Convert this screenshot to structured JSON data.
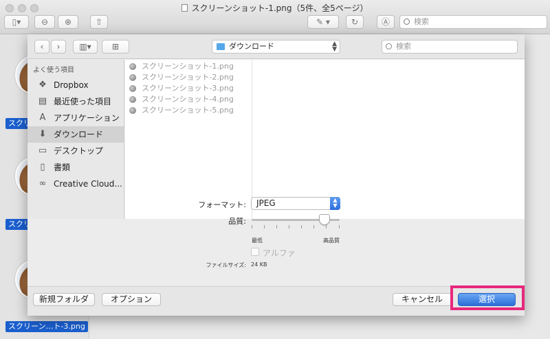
{
  "window": {
    "title": "スクリーンショット-1.png（5件、全5ページ）",
    "search_placeholder": "検索"
  },
  "thumbnails": {
    "labels": [
      "スクリー",
      "スクリー",
      "スクリーン…ト-3.png"
    ]
  },
  "sheet": {
    "location": "ダウンロード",
    "search_placeholder": "検索",
    "sidebar": {
      "heading": "よく使う項目",
      "items": [
        {
          "label": "Dropbox",
          "icon": "dropbox-icon"
        },
        {
          "label": "最近使った項目",
          "icon": "recents-icon"
        },
        {
          "label": "アプリケーション",
          "icon": "applications-icon"
        },
        {
          "label": "ダウンロード",
          "icon": "downloads-icon",
          "selected": true
        },
        {
          "label": "デスクトップ",
          "icon": "desktop-icon"
        },
        {
          "label": "書類",
          "icon": "documents-icon"
        },
        {
          "label": "Creative Cloud...",
          "icon": "creative-cloud-icon"
        }
      ]
    },
    "files": [
      "スクリーンショット-1.png",
      "スクリーンショット-2.png",
      "スクリーンショット-3.png",
      "スクリーンショット-4.png",
      "スクリーンショット-5.png"
    ],
    "options": {
      "format_label": "フォーマット:",
      "format_value": "JPEG",
      "quality_label": "品質:",
      "quality_min": "最低",
      "quality_max": "高品質",
      "quality_level": 0.83,
      "alpha_label": "アルファ",
      "alpha_checked": false,
      "filesize_label": "ファイルサイズ:",
      "filesize_value": "24 KB"
    },
    "buttons": {
      "new_folder": "新規フォルダ",
      "options": "オプション",
      "cancel": "キャンセル",
      "choose": "選択"
    }
  },
  "colors": {
    "accent": "#2b6fd8",
    "highlight": "#e6287c"
  }
}
